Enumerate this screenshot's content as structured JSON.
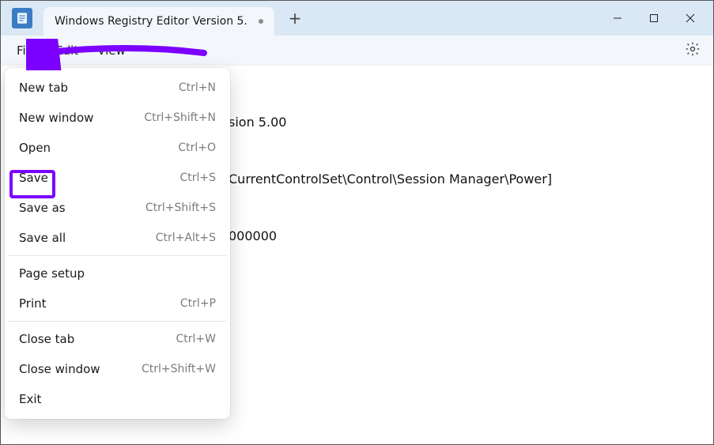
{
  "app": {
    "tab_title": "Windows Registry Editor Version 5."
  },
  "menubar": {
    "file": "File",
    "edit": "Edit",
    "view": "View"
  },
  "file_menu": {
    "items": [
      {
        "label": "New tab",
        "shortcut": "Ctrl+N"
      },
      {
        "label": "New window",
        "shortcut": "Ctrl+Shift+N"
      },
      {
        "label": "Open",
        "shortcut": "Ctrl+O"
      },
      {
        "label": "Save",
        "shortcut": "Ctrl+S"
      },
      {
        "label": "Save as",
        "shortcut": "Ctrl+Shift+S"
      },
      {
        "label": "Save all",
        "shortcut": "Ctrl+Alt+S"
      },
      {
        "label": "Page setup",
        "shortcut": ""
      },
      {
        "label": "Print",
        "shortcut": "Ctrl+P"
      },
      {
        "label": "Close tab",
        "shortcut": "Ctrl+W"
      },
      {
        "label": "Close window",
        "shortcut": "Ctrl+Shift+W"
      },
      {
        "label": "Exit",
        "shortcut": ""
      }
    ]
  },
  "editor": {
    "line1_suffix": "sion 5.00",
    "line2_suffix": "CurrentControlSet\\Control\\Session Manager\\Power]",
    "line3_suffix": "000000"
  }
}
